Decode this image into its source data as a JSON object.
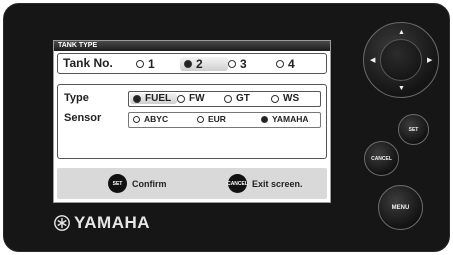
{
  "screen": {
    "title": "TANK TYPE",
    "tank": {
      "label": "Tank No.",
      "options": [
        {
          "label": "1",
          "selected": false
        },
        {
          "label": "2",
          "selected": true
        },
        {
          "label": "3",
          "selected": false
        },
        {
          "label": "4",
          "selected": false
        }
      ]
    },
    "type": {
      "label": "Type",
      "options": [
        {
          "label": "FUEL",
          "selected": true
        },
        {
          "label": "FW",
          "selected": false
        },
        {
          "label": "GT",
          "selected": false
        },
        {
          "label": "WS",
          "selected": false
        }
      ]
    },
    "sensor": {
      "label": "Sensor",
      "options": [
        {
          "label": "ABYC",
          "selected": false
        },
        {
          "label": "EUR",
          "selected": false
        },
        {
          "label": "YAMAHA",
          "selected": true
        }
      ]
    },
    "footer": {
      "confirm_icon": "SET",
      "confirm_label": "Confirm",
      "exit_icon": "CANCEL",
      "exit_label": "Exit screen."
    }
  },
  "brand": {
    "name": "YAMAHA"
  },
  "hardware": {
    "arrows": {
      "up": "▲",
      "down": "▼",
      "left": "◀",
      "right": "▶"
    },
    "set_label": "SET",
    "cancel_label": "CANCEL",
    "menu_label": "MENU"
  },
  "colors": {
    "bezel": "#161616",
    "screen_bg": "#ffffff",
    "footer_bg": "#d9d9d9",
    "selected_dot": "#222222"
  }
}
